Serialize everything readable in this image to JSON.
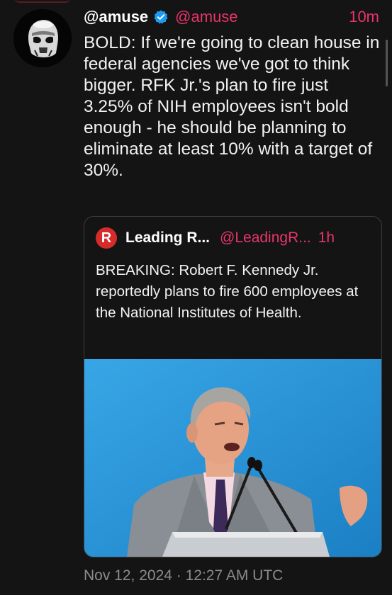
{
  "tweet": {
    "display_name": "@amuse",
    "handle": "@amuse",
    "time": "10m",
    "text": "BOLD: If we're going to clean house in federal agencies we've got to think bigger. RFK Jr.'s plan to fire just 3.25% of NIH employees isn't bold enough - he should be planning to eliminate at least 10% with a target of 30%.",
    "timestamp": "Nov 12, 2024 · 12:27 AM UTC"
  },
  "quoted": {
    "logo_letter": "R",
    "display_name": "Leading R...",
    "handle": "@LeadingR...",
    "time": "1h",
    "text": "BREAKING: Robert F. Kennedy Jr. reportedly plans to fire 600 employees at the National Institutes of Health."
  },
  "colors": {
    "background": "#141414",
    "accent": "#e8356b",
    "verified": "#1d9bf0",
    "logo": "#d62b2b",
    "image_bg": "#2a93d4"
  },
  "icons": {
    "verified": "verified-badge-icon",
    "avatar": "stormtrooper-avatar"
  }
}
